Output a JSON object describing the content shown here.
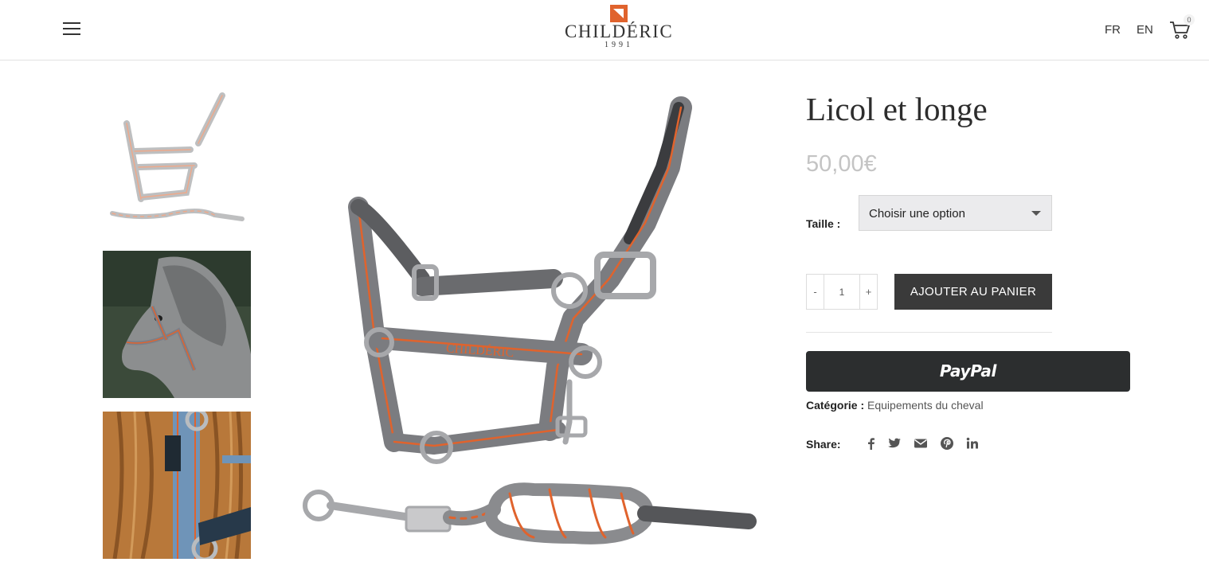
{
  "header": {
    "brand_name": "CHILDÉRIC",
    "brand_year": "1991",
    "lang_fr": "FR",
    "lang_en": "EN",
    "cart_count": "0"
  },
  "product": {
    "title": "Licol et longe",
    "price": "50,00€",
    "size_label": "Taille :",
    "size_select_value": "Choisir une option",
    "quantity": "1",
    "qty_minus": "-",
    "qty_plus": "+",
    "add_to_cart": "AJOUTER AU PANIER",
    "paypal": "PayPal",
    "category_label": "Catégorie :",
    "category_value": "Equipements du cheval",
    "share_label": "Share:",
    "share_icons": [
      "facebook-icon",
      "twitter-icon",
      "email-icon",
      "pinterest-icon",
      "linkedin-icon"
    ],
    "halter_watermark": "CHILDÉRIC"
  },
  "colors": {
    "accent_orange": "#e0632d",
    "halter_grey": "#8a8b8e",
    "button_dark": "#3a3a3a",
    "paypal_bg": "#2c2e2f",
    "price_grey": "#c4c4c4"
  }
}
